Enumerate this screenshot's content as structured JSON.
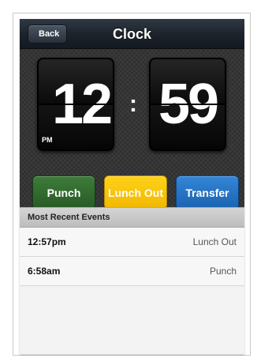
{
  "navbar": {
    "back_label": "Back",
    "title": "Clock"
  },
  "clock": {
    "hours": "12",
    "minutes": "59",
    "ampm": "PM",
    "separator": ":"
  },
  "actions": {
    "punch_label": "Punch",
    "lunch_out_label": "Lunch Out",
    "transfer_label": "Transfer",
    "colors": {
      "punch": "#2e6b2c",
      "lunch_out": "#f7c600",
      "transfer": "#2474c4"
    }
  },
  "events": {
    "header": "Most Recent Events",
    "rows": [
      {
        "time": "12:57pm",
        "event": "Lunch Out"
      },
      {
        "time": "6:58am",
        "event": "Punch"
      }
    ]
  }
}
